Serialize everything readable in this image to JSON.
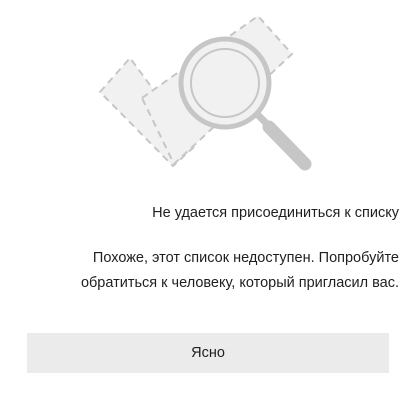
{
  "dialog": {
    "title": "Не удается присоединиться к списку",
    "message_line1": "Похоже, этот список недоступен. Попробуйте",
    "message_line2": "обратиться к человеку, который пригласил вас.",
    "ok_label": "Ясно"
  },
  "illustration": {
    "icon": "magnifier-icon",
    "stroke_color": "#c6c6c6",
    "fill_color": "#f1f1f1"
  }
}
